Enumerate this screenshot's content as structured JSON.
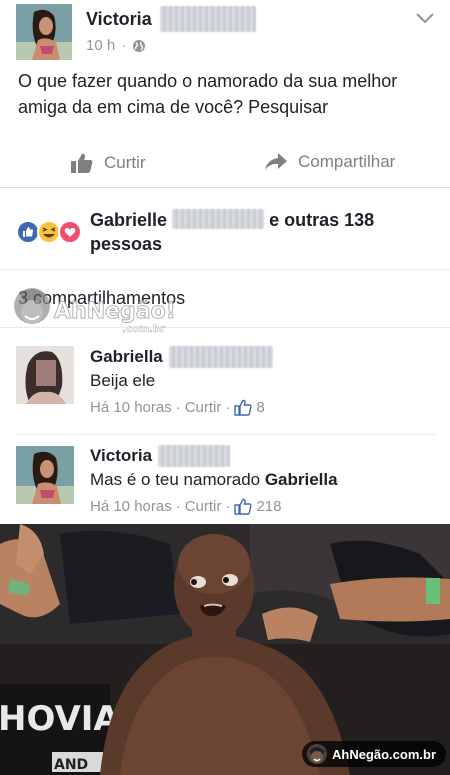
{
  "post": {
    "author": "Victoria",
    "time": "10 h",
    "text": "O que fazer quando o namorado da sua melhor amiga da em cima de você? Pesquisar"
  },
  "actions": {
    "like_label": "Curtir",
    "share_label": "Compartilhar"
  },
  "reactions": {
    "name": "Gabrielle",
    "rest": "e outras 138 pessoas"
  },
  "shares": {
    "text": "3 compartilhamentos"
  },
  "watermark": {
    "top_line1": "AhNegão!",
    "top_line2": ".com.br",
    "bottom": "AhNegão.com.br"
  },
  "comments": [
    {
      "author": "Gabriella",
      "text": "Beija ele",
      "time": "Há 10 horas",
      "reply": "Curtir",
      "likes": "8"
    },
    {
      "author": "Victoria",
      "text_prefix": "Mas é o teu namorado ",
      "mention": "Gabriella",
      "time": "Há 10 horas",
      "reply": "Curtir",
      "likes": "218"
    }
  ],
  "photo": {
    "banner_text": "HOVIA",
    "banner_text2": "AND"
  },
  "colors": {
    "like_blue": "#4267b2",
    "meta_gray": "#90949c",
    "text": "#1d2129"
  }
}
